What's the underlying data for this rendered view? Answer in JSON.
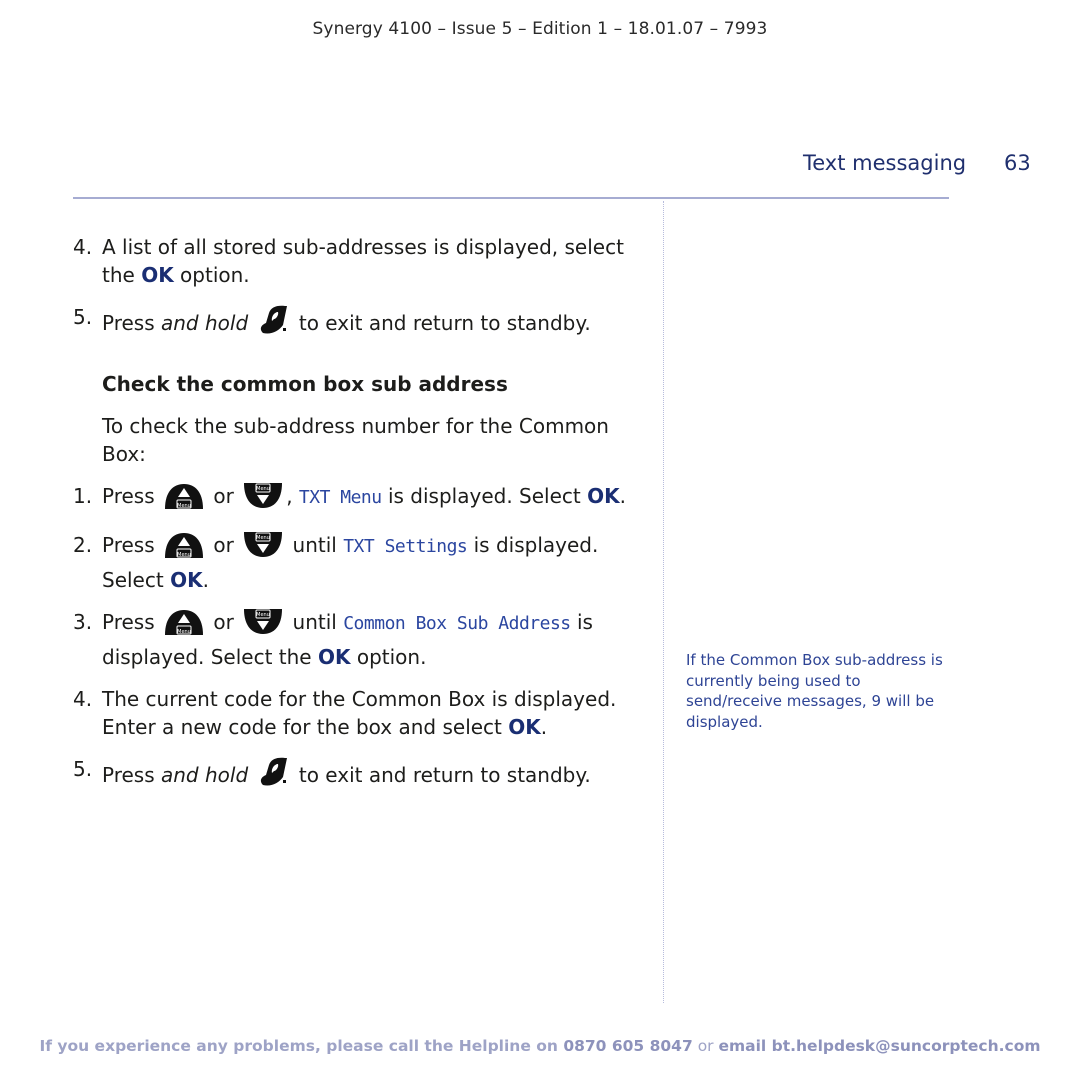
{
  "header": {
    "meta": "Synergy 4100 – Issue 5 – Edition 1 – 18.01.07 – 7993",
    "section_title": "Text messaging",
    "page_number": "63"
  },
  "steps_top": [
    {
      "num": "4.",
      "pre": "A list of all stored sub-addresses is displayed, select the ",
      "ok": "OK",
      "post": " option."
    },
    {
      "num": "5.",
      "pre": "Press ",
      "em": "and hold",
      "post": " to exit and return to standby.",
      "icon": "end-call-key-icon"
    }
  ],
  "section": {
    "heading": "Check the common box sub address",
    "intro": "To check the sub-address number for the Common Box:",
    "press": "Press",
    "or": "or",
    "menu_label": "Menu",
    "steps": [
      {
        "num": "1.",
        "mid": ", ",
        "lcd": "TXT Menu",
        "post": " is displayed. Select ",
        "ok": "OK",
        "end": "."
      },
      {
        "num": "2.",
        "mid": " until ",
        "lcd": "TXT Settings",
        "post": " is displayed. Select ",
        "ok": "OK",
        "end": "."
      },
      {
        "num": "3.",
        "mid": " until ",
        "lcd": "Common Box Sub Address",
        "post": " is displayed. Select the ",
        "ok": "OK",
        "end": " option."
      },
      {
        "num": "4.",
        "pre": "The current code for the Common Box is displayed. Enter a new code for the box and select ",
        "ok": "OK",
        "end": "."
      },
      {
        "num": "5.",
        "pre": "Press ",
        "em": "and hold",
        "post": " to exit and return to standby.",
        "icon": "end-call-key-icon"
      }
    ]
  },
  "side_note": "If the Common Box sub-address is currently being used to send/receive messages, 9 will be displayed.",
  "footer": {
    "pre": "If you experience any problems, please call the Helpline on ",
    "phone": "0870 605 8047",
    "or": " or ",
    "email_label": "email bt.helpdesk@suncorptech.com"
  },
  "colors": {
    "accent": "#1f2f6e",
    "ok": "#1a2e73",
    "lcd": "#2b46a0",
    "note": "#2e4495",
    "rule": "#a6acd2",
    "footer": "#9ea3c6"
  }
}
